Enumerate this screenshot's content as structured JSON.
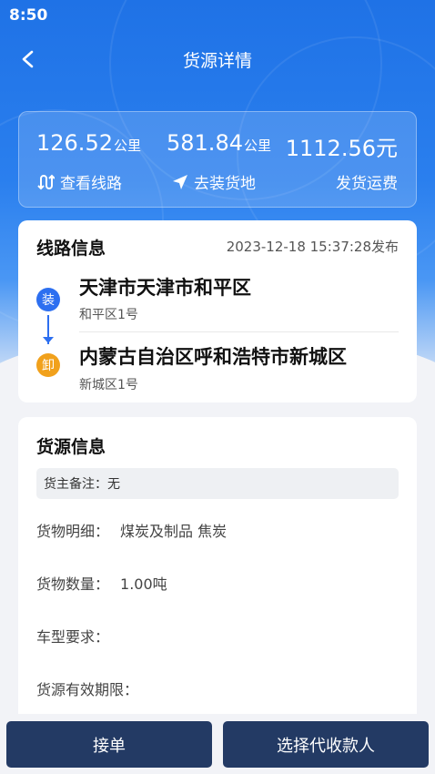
{
  "status_bar": {
    "time": "8:50"
  },
  "nav": {
    "title": "货源详情"
  },
  "summary": {
    "distance1": {
      "value": "126.52",
      "unit": "公里"
    },
    "distance2": {
      "value": "581.84",
      "unit": "公里"
    },
    "freight": {
      "value": "1112.56元"
    },
    "actions": {
      "view_route": "查看线路",
      "go_loading": "去装货地",
      "freight_label": "发货运费"
    }
  },
  "route": {
    "title": "线路信息",
    "published": "2023-12-18 15:37:28发布",
    "load": {
      "badge": "装",
      "city": "天津市天津市和平区",
      "address": "和平区1号"
    },
    "unload": {
      "badge": "卸",
      "city": "内蒙古自治区呼和浩特市新城区",
      "address": "新城区1号"
    }
  },
  "cargo": {
    "title": "货源信息",
    "note_label": "货主备注：",
    "note_value": "无",
    "fields": [
      {
        "label": "货物明细：",
        "value": "煤炭及制品  焦炭"
      },
      {
        "label": "货物数量：",
        "value": "1.00吨"
      },
      {
        "label": "车型要求：",
        "value": ""
      },
      {
        "label": "货源有效期限：",
        "value": ""
      }
    ]
  },
  "buttons": {
    "accept": "接单",
    "choose_payee": "选择代收款人"
  },
  "colors": {
    "primary": "#1f72e6",
    "load_badge": "#2d6ff0",
    "unload_badge": "#f1a11c",
    "button": "#233a64"
  }
}
